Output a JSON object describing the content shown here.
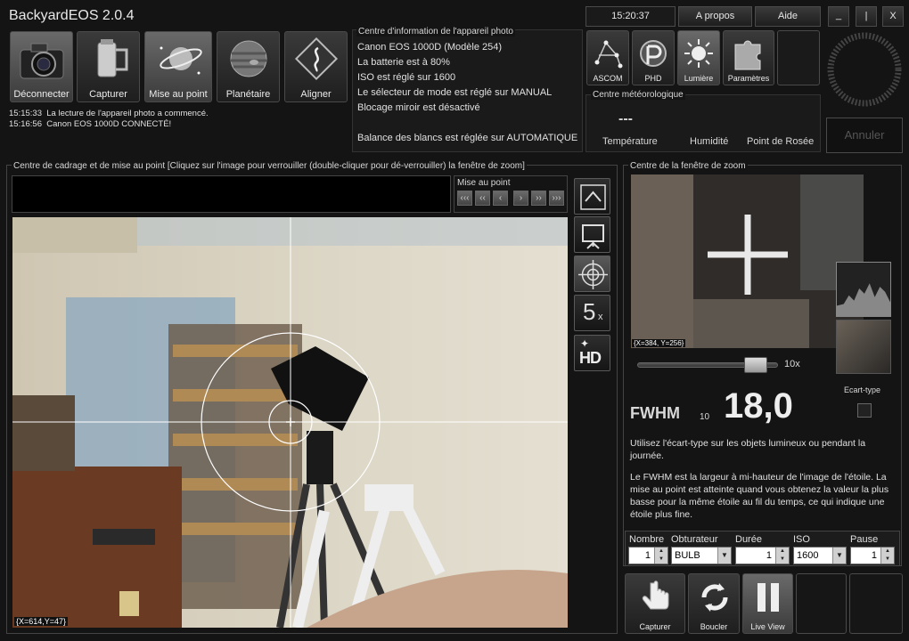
{
  "app": {
    "title": "BackyardEOS 2.0.4"
  },
  "toolbar": {
    "disconnect": "Déconnecter",
    "capture": "Capturer",
    "focus": "Mise au point",
    "planetary": "Planétaire",
    "align": "Aligner"
  },
  "log": [
    {
      "time": "15:15:33",
      "text": "La lecture de l'appareil photo a commencé."
    },
    {
      "time": "15:16:56",
      "text": "Canon EOS 1000D CONNECTÉ!"
    }
  ],
  "camera_info": {
    "title": "Centre d'information de l'appareil photo",
    "lines": [
      "Canon EOS 1000D   (Modèle 254)",
      "La batterie est à 80%",
      "ISO est réglé sur 1600",
      "Le sélecteur de mode est réglé sur MANUAL",
      "Blocage miroir est désactivé",
      "",
      "Balance des blancs est réglée sur AUTOMATIQUE"
    ]
  },
  "header": {
    "clock": "15:20:37",
    "about": "A propos",
    "help": "Aide",
    "minimize": "_",
    "restore": "|",
    "close": "X"
  },
  "plugins": {
    "ascom": "ASCOM",
    "phd": "PHD",
    "light": "Lumière",
    "settings": "Paramètres"
  },
  "weather": {
    "title": "Centre météorologique",
    "value": "---",
    "temperature": "Température",
    "humidity": "Humidité",
    "dew_point": "Point de Rosée"
  },
  "cancel": "Annuler",
  "framing": {
    "title": "Centre de cadrage et de mise au point  [Cliquez sur l'image pour verrouiller (double-cliquer pour dé-verrouiller) la fenêtre de zoom]",
    "focus_nav_label": "Mise au point",
    "focus_nav_buttons": [
      "‹‹‹",
      "‹‹",
      "‹",
      "›",
      "››",
      "›››"
    ],
    "coords": "{X=614,Y=47}",
    "zoom_label": "5",
    "zoom_suffix": "x",
    "hd_label": "HD"
  },
  "zoom_window": {
    "title": "Centre de la fenêtre de zoom",
    "coords": "{X=384, Y=256}",
    "zoom_level": "10x",
    "zoom_fraction": 0.91,
    "stddev_label": "Ecart-type",
    "fwhm_label": "FWHM",
    "fwhm_sub": "10",
    "fwhm_value": "18,0",
    "help1": "Utilisez l'écart-type sur les objets lumineux ou pendant la journée.",
    "help2": "Le FWHM est la largeur à mi-hauteur de l'image de l'étoile. La mise au point est atteinte quand vous obtenez la valeur la plus basse pour la même étoile au fil du temps, ce qui indique une étoile plus fine."
  },
  "exposure": {
    "count_label": "Nombre",
    "count": "1",
    "shutter_label": "Obturateur",
    "shutter": "BULB",
    "duration_label": "Durée",
    "duration": "1",
    "iso_label": "ISO",
    "iso": "1600",
    "pause_label": "Pause",
    "pause": "1"
  },
  "actions": {
    "capture": "Capturer",
    "loop": "Boucler",
    "liveview": "Live View"
  }
}
